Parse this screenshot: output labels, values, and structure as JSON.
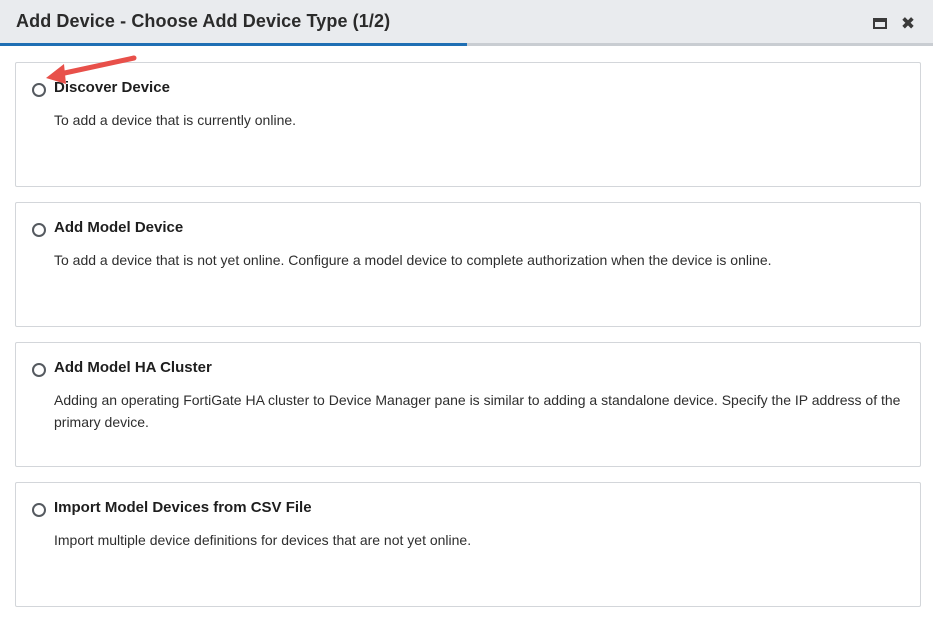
{
  "dialog": {
    "title": "Add Device - Choose Add Device Type (1/2)",
    "progress_fraction": 0.5,
    "controls": {
      "maximize_icon": "maximize-icon",
      "close_icon": "close-icon",
      "close_glyph": "✖"
    }
  },
  "options": [
    {
      "title": "Discover Device",
      "description": "To add a device that is currently online.",
      "selected": false
    },
    {
      "title": "Add Model Device",
      "description": "To add a device that is not yet online. Configure a model device to complete authorization when the device is online.",
      "selected": false
    },
    {
      "title": "Add Model HA Cluster",
      "description": "Adding an operating FortiGate HA cluster to Device Manager pane is similar to adding a standalone device. Specify the IP address of the primary device.",
      "selected": false
    },
    {
      "title": "Import Model Devices from CSV File",
      "description": "Import multiple device definitions for devices that are not yet online.",
      "selected": false
    }
  ],
  "annotation": {
    "arrow_color": "#e8504a"
  },
  "colors": {
    "accent": "#1f6fb4",
    "titlebar": "#e9ebee"
  }
}
